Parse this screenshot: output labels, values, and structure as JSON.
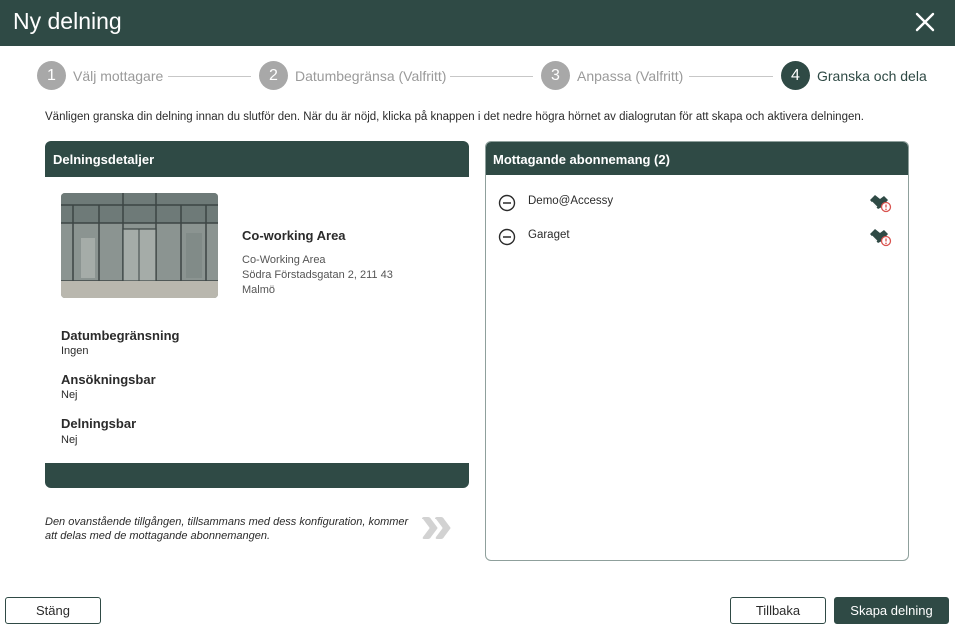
{
  "dialog": {
    "title": "Ny delning",
    "close_icon": "close-icon"
  },
  "steps": [
    {
      "number": "1",
      "label": "Välj mottagare",
      "state": "done"
    },
    {
      "number": "2",
      "label": "Datumbegränsa (Valfritt)",
      "state": "done"
    },
    {
      "number": "3",
      "label": "Anpassa (Valfritt)",
      "state": "done"
    },
    {
      "number": "4",
      "label": "Granska och dela",
      "state": "active"
    }
  ],
  "intro_text": "Vänligen granska din delning innan du slutför den. När du är nöjd, klicka på knappen i det nedre högra hörnet av dialogrutan för att skapa och aktivera delningen.",
  "details_panel": {
    "header": "Delningsdetaljer",
    "asset": {
      "name": "Co-working Area",
      "type_label": "Co-Working Area",
      "street": "Södra Förstadsgatan 2, 211 43",
      "city": "Malmö"
    },
    "fields": [
      {
        "label": "Datumbegränsning",
        "value": "Ingen"
      },
      {
        "label": "Ansökningsbar",
        "value": "Nej"
      },
      {
        "label": "Delningsbar",
        "value": "Nej"
      }
    ]
  },
  "note": "Den ovanstående tillgången, tillsammans med dess konfiguration, kommer att delas med de mottagande abonnemangen.",
  "recipients_panel": {
    "header": "Mottagande abonnemang (2)",
    "items": [
      {
        "name": "Demo@Accessy",
        "remove_icon": "minus-circle-icon",
        "permission_icon": "handshake-alert-icon"
      },
      {
        "name": "Garaget",
        "remove_icon": "minus-circle-icon",
        "permission_icon": "handshake-alert-icon"
      }
    ]
  },
  "footer": {
    "close_label": "Stäng",
    "back_label": "Tillbaka",
    "create_label": "Skapa delning"
  },
  "colors": {
    "primary": "#2f4a45",
    "inactive_step": "#a8a8a8",
    "alert": "#d9534f"
  }
}
